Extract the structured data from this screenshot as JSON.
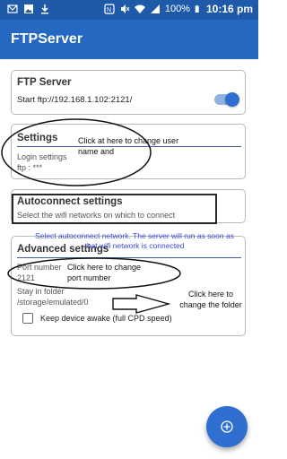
{
  "status_bar": {
    "battery_percent": "100%",
    "time": "10:16 pm",
    "icons": [
      "mail-icon",
      "image-icon",
      "download-icon",
      "nfc-icon",
      "mute-icon",
      "wifi-icon",
      "signal-icon",
      "battery-icon"
    ]
  },
  "app_bar": {
    "title": "FTPServer"
  },
  "ftp_server_card": {
    "title": "FTP Server",
    "subtitle": "Start ftp://192.168.1.102:2121/",
    "toggle_on": true
  },
  "settings_card": {
    "title": "Settings",
    "line1": "Login settings",
    "line2": "ftp : ***",
    "annotation": "Click at here to change user name and"
  },
  "autoconnect_card": {
    "title": "Autoconnect settings",
    "subtitle": "Select the wifi networks on which to connect",
    "annotation": "Select autoconnect network. The server will run as soon as that wifi network is connected"
  },
  "advanced_card": {
    "title": "Advanced settings",
    "port_label": "Port number",
    "port_value": "2121",
    "port_annotation": "Click here to change port number",
    "folder_label": "Stay in folder",
    "folder_value": "/storage/emulated/0",
    "folder_annotation": "Click here to change the folder",
    "keep_awake_label": "Keep device awake (full CPD speed)",
    "keep_awake_checked": false
  },
  "fab": {
    "icon": "add-circle-icon"
  },
  "colors": {
    "status_bar": "#1f5aa8",
    "app_bar": "#2468c1",
    "accent": "#2f6fd0",
    "annotation_blue": "#3a4bd1"
  }
}
